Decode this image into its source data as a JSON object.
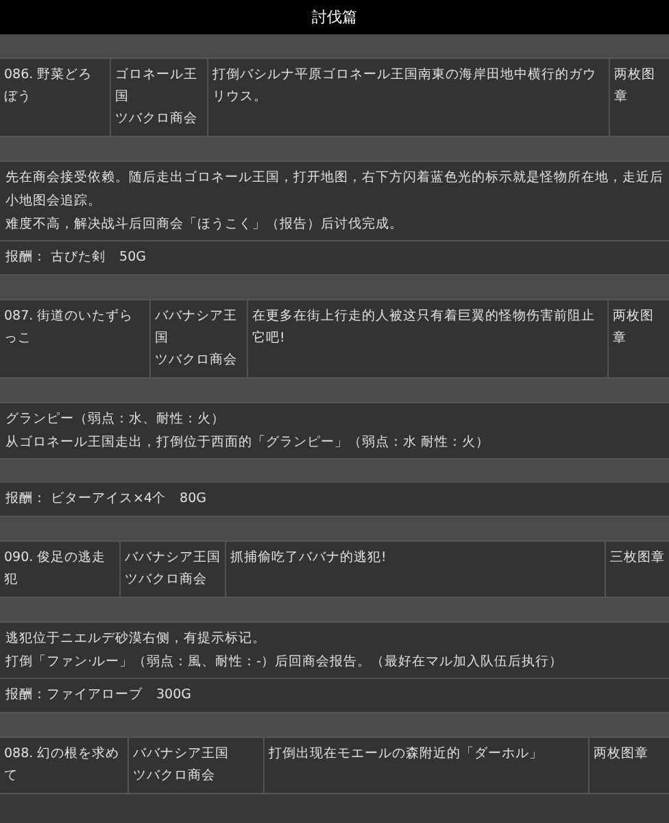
{
  "title": "討伐篇",
  "blocks": [
    {
      "kind": "spacer"
    },
    {
      "kind": "quest",
      "name": "086. 野菜どろぼう",
      "places": [
        "ゴロネール王国",
        "ツバクロ商会"
      ],
      "content": "打倒バシルナ平原ゴロネール王国南東の海岸田地中横行的ガウリウス。",
      "prize": "两枚图章"
    },
    {
      "kind": "spacer"
    },
    {
      "kind": "description",
      "lines": [
        "先在商会接受依赖。随后走出ゴロネール王国，打开地图，右下方闪着蓝色光的标示就是怪物所在地，走近后小地图会追踪。",
        "难度不高，解决战斗后回商会「ほうこく」（报告）后讨伐完成。"
      ]
    },
    {
      "kind": "reward",
      "text": "报酬： 古びた剣　50G"
    },
    {
      "kind": "spacer"
    },
    {
      "kind": "quest",
      "name": "087. 街道のいたずらっこ",
      "places": [
        "ババナシア王国",
        "ツバクロ商会"
      ],
      "content": "在更多在街上行走的人被这只有着巨翼的怪物伤害前阻止它吧!",
      "prize": "两枚图章"
    },
    {
      "kind": "spacer"
    },
    {
      "kind": "description",
      "lines": [
        "グランピー（弱点：水、耐性：火）",
        "从ゴロネール王国走出，打倒位于西面的「グランピー」（弱点：水 耐性：火）"
      ]
    },
    {
      "kind": "spacer"
    },
    {
      "kind": "reward",
      "text": "报酬： ビターアイス×4个　80G"
    },
    {
      "kind": "spacer"
    },
    {
      "kind": "quest",
      "name": "090. 俊足の逃走犯",
      "places": [
        "ババナシア王国",
        "ツバクロ商会"
      ],
      "content": "抓捕偷吃了ババナ的逃犯!",
      "prize": "三枚图章"
    },
    {
      "kind": "spacer"
    },
    {
      "kind": "description",
      "lines": [
        "逃犯位于ニエルデ砂漠右侧，有提示标记。",
        "打倒「ファン·ルー」（弱点：風、耐性：-）后回商会报告。（最好在マル加入队伍后执行）"
      ]
    },
    {
      "kind": "reward",
      "text": "报酬：ファイアローブ　300G"
    },
    {
      "kind": "spacer"
    },
    {
      "kind": "quest",
      "name": "088. 幻の根を求めて",
      "places": [
        "ババナシア王国",
        "ツバクロ商会"
      ],
      "content": "打倒出现在モエールの森附近的「ダーホル」",
      "prize": "两枚图章"
    }
  ]
}
